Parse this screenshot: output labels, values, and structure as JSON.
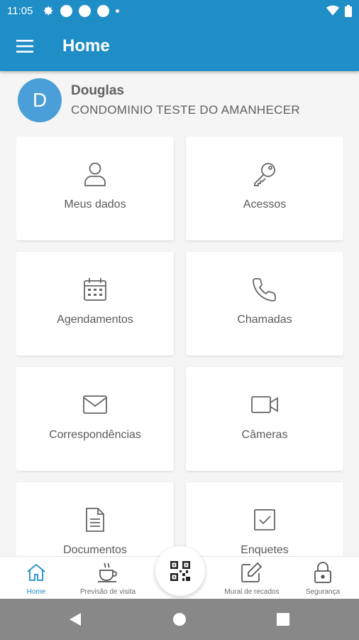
{
  "status_bar": {
    "time": "11:05",
    "icons": [
      "settings-icon",
      "notification-dot-icon",
      "notification-dot-icon",
      "notification-dot-icon",
      "small-dot-icon",
      "wifi-icon",
      "battery-icon"
    ]
  },
  "app_bar": {
    "title": "Home",
    "menu_icon": "hamburger-menu-icon"
  },
  "profile": {
    "initial": "D",
    "name": "Douglas",
    "condominium": "CONDOMINIO TESTE DO AMANHECER"
  },
  "menu": {
    "items": [
      {
        "label": "Meus dados",
        "icon": "user-icon"
      },
      {
        "label": "Acessos",
        "icon": "key-icon"
      },
      {
        "label": "Agendamentos",
        "icon": "calendar-icon"
      },
      {
        "label": "Chamadas",
        "icon": "phone-icon"
      },
      {
        "label": "Correspondências",
        "icon": "mail-icon"
      },
      {
        "label": "Câmeras",
        "icon": "video-camera-icon"
      },
      {
        "label": "Documentos",
        "icon": "document-icon"
      },
      {
        "label": "Enquetes",
        "icon": "checkbox-icon"
      }
    ]
  },
  "bottom_nav": {
    "items": [
      {
        "label": "Home",
        "icon": "home-icon",
        "active": true
      },
      {
        "label": "Previsão de visita",
        "icon": "coffee-cup-icon",
        "active": false
      },
      {
        "label": "Mural de recados",
        "icon": "edit-note-icon",
        "active": false
      },
      {
        "label": "Segurança",
        "icon": "lock-icon",
        "active": false
      }
    ],
    "center_action_icon": "qr-code-icon"
  },
  "colors": {
    "primary": "#1f8ec7",
    "avatar": "#4a9fd8",
    "background": "#f5f5f5",
    "card": "#ffffff",
    "text": "#5a5a5a",
    "system_nav": "#888888"
  }
}
